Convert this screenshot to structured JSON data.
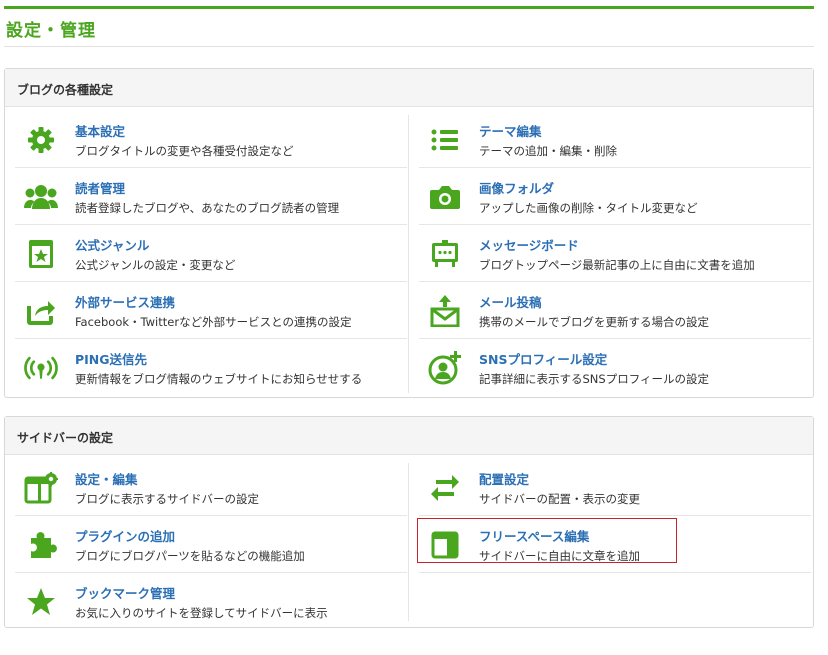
{
  "page": {
    "title": "設定・管理",
    "accent": "#4aa61f",
    "link_color": "#2b6fb5"
  },
  "blog_settings": {
    "heading": "ブログの各種設定",
    "items": [
      {
        "title": "基本設定",
        "desc": "ブログタイトルの変更や各種受付設定など",
        "icon": "gear-icon"
      },
      {
        "title": "テーマ編集",
        "desc": "テーマの追加・編集・削除",
        "icon": "list-icon"
      },
      {
        "title": "読者管理",
        "desc": "読者登録したブログや、あなたのブログ読者の管理",
        "icon": "users-icon"
      },
      {
        "title": "画像フォルダ",
        "desc": "アップした画像の削除・タイトル変更など",
        "icon": "camera-icon"
      },
      {
        "title": "公式ジャンル",
        "desc": "公式ジャンルの設定・変更など",
        "icon": "bookmark-star-icon"
      },
      {
        "title": "メッセージボード",
        "desc": "ブログトップページ最新記事の上に自由に文書を追加",
        "icon": "message-board-icon"
      },
      {
        "title": "外部サービス連携",
        "desc": "Facebook・Twitterなど外部サービスとの連携の設定",
        "icon": "share-icon"
      },
      {
        "title": "メール投稿",
        "desc": "携帯のメールでブログを更新する場合の設定",
        "icon": "mail-upload-icon"
      },
      {
        "title": "PING送信先",
        "desc": "更新情報をブログ情報のウェブサイトにお知らせせする",
        "icon": "broadcast-icon"
      },
      {
        "title": "SNSプロフィール設定",
        "desc": "記事詳細に表示するSNSプロフィールの設定",
        "icon": "profile-add-icon"
      }
    ]
  },
  "sidebar_settings": {
    "heading": "サイドバーの設定",
    "items": [
      {
        "title": "設定・編集",
        "desc": "ブログに表示するサイドバーの設定",
        "icon": "layout-gear-icon"
      },
      {
        "title": "配置設定",
        "desc": "サイドバーの配置・表示の変更",
        "icon": "swap-arrows-icon"
      },
      {
        "title": "プラグインの追加",
        "desc": "ブログにブログパーツを貼るなどの機能追加",
        "icon": "puzzle-icon"
      },
      {
        "title": "フリースペース編集",
        "desc": "サイドバーに自由に文章を追加",
        "icon": "free-space-icon"
      },
      {
        "title": "ブックマーク管理",
        "desc": "お気に入りのサイトを登録してサイドバーに表示",
        "icon": "star-icon"
      }
    ]
  }
}
